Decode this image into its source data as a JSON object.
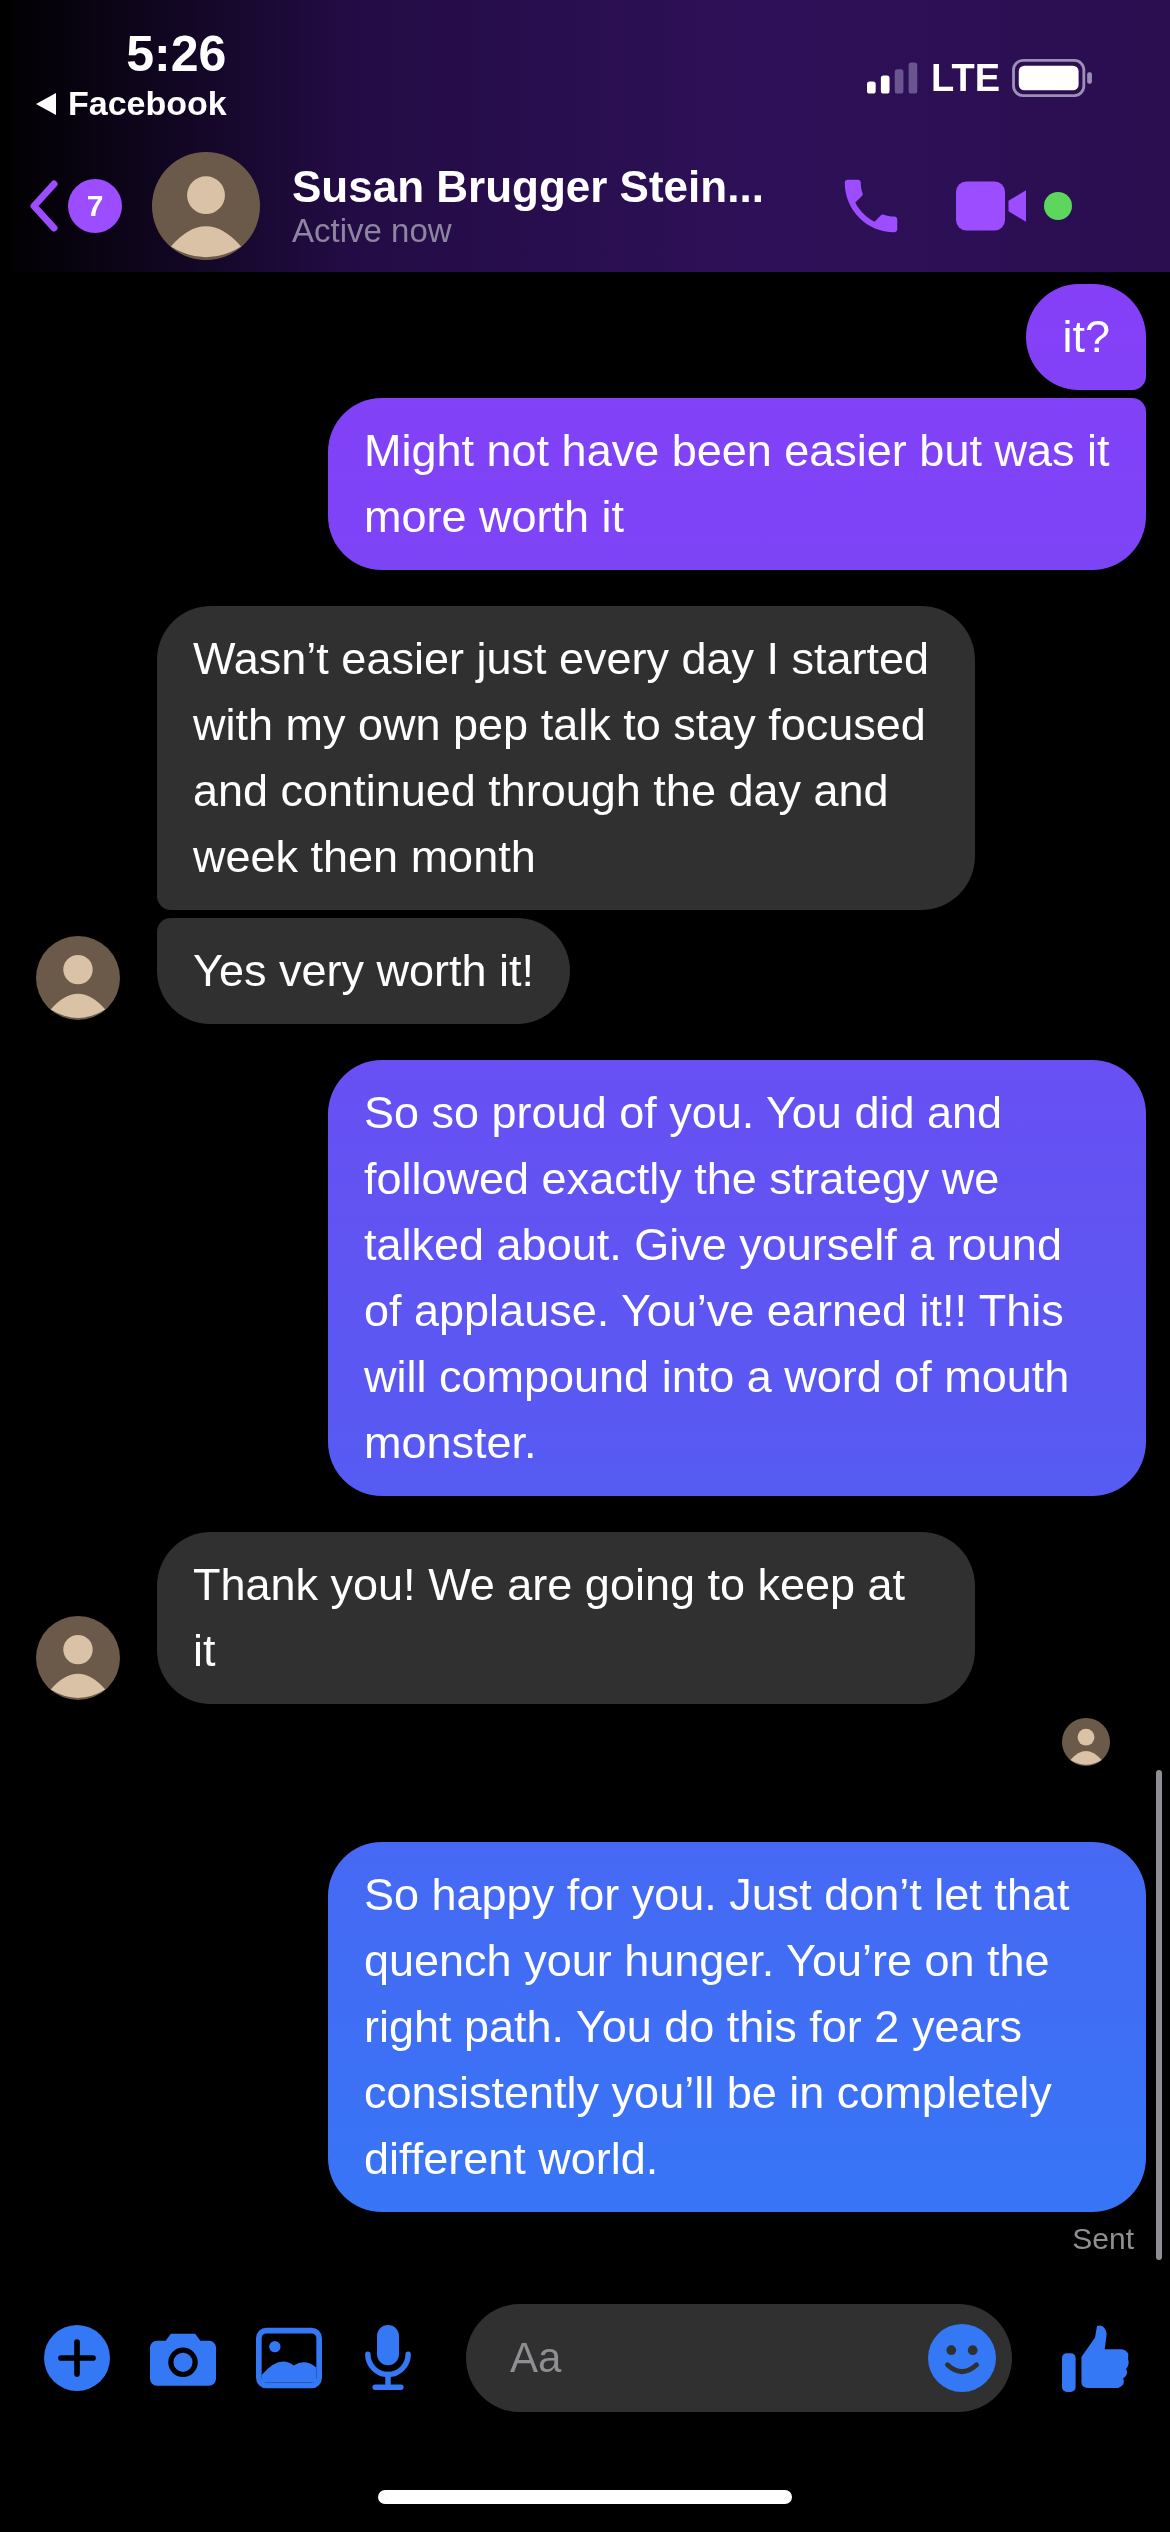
{
  "status_bar": {
    "time": "5:26",
    "back_label": "Facebook",
    "network": "LTE"
  },
  "header": {
    "unread_count": "7",
    "name": "Susan Brugger Stein...",
    "status": "Active now",
    "online": true
  },
  "messages": [
    {
      "kind": "sent",
      "text": "it?"
    },
    {
      "kind": "sent",
      "text": "Might not have been easier but was it more worth it"
    },
    {
      "kind": "received",
      "text": "Wasn’t easier just every day I started with my own pep talk to stay focused and continued through the day and week then month"
    },
    {
      "kind": "received",
      "text": "Yes very worth it!"
    },
    {
      "kind": "sent",
      "text": "So so proud of you. You did and followed exactly the strategy we talked about. Give yourself a round of applause. You’ve earned it!! This will compound into a word of mouth monster."
    },
    {
      "kind": "received",
      "text": "Thank you!  We are going to keep at it"
    },
    {
      "kind": "read_receipt"
    },
    {
      "kind": "sent",
      "text": "So happy for you. Just don’t let that quench your hunger. You’re on the right path. You do this for 2 years consistently you’ll be in completely different world."
    }
  ],
  "delivery_status": "Sent",
  "composer": {
    "placeholder": "Aa"
  }
}
